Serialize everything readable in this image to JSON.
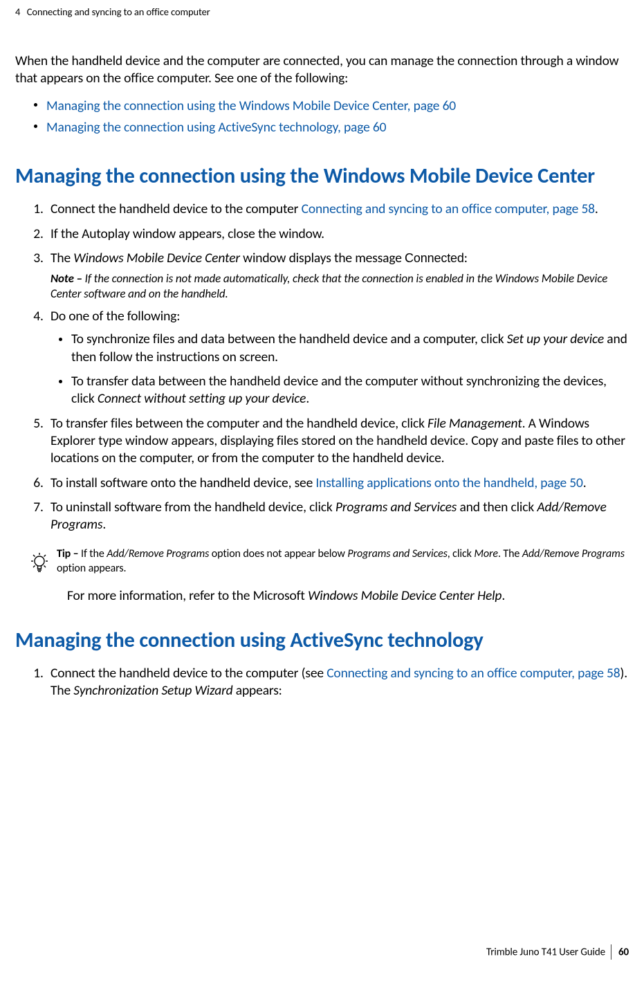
{
  "header": {
    "chapter_num": "4",
    "chapter_title": "Connecting and syncing to an office computer"
  },
  "intro": "When the handheld device and the computer are connected, you can manage the connection through a window that appears on the office computer. See one of the following:",
  "top_links": [
    "Managing the connection using the Windows Mobile Device Center, page 60",
    "Managing the connection using ActiveSync technology, page 60"
  ],
  "section1": {
    "heading": "Managing the connection using the Windows Mobile Device Center",
    "step1_a": "Connect the handheld device to the computer ",
    "step1_link": "Connecting and syncing to an office computer, page 58",
    "step1_b": ".",
    "step2": "If the Autoplay window appears, close the window.",
    "step3_a": "The ",
    "step3_i": "Windows Mobile Device Center",
    "step3_b": " window displays the message ",
    "step3_ui": "Connected",
    "step3_c": ":",
    "note_label": "Note  – ",
    "note_body": "If the connection is not made automatically, check that the connection is enabled in the Windows Mobile Device Center software and on the handheld.",
    "step4": "Do one of the following:",
    "step4_bullet1_a": "To synchronize files and data between the handheld device and a computer, click ",
    "step4_bullet1_i": "Set up your device",
    "step4_bullet1_b": " and then follow the instructions on screen.",
    "step4_bullet2_a": "To transfer data between the handheld device and the computer without synchronizing the devices, click ",
    "step4_bullet2_i": "Connect without setting up your device",
    "step4_bullet2_b": ".",
    "step5_a": "To transfer files between the computer and the handheld device, click ",
    "step5_i": "File Management",
    "step5_b": ". A Windows Explorer type window appears, displaying files stored on the handheld device. Copy and paste files to other locations on the computer, or from the computer to the handheld device.",
    "step6_a": "To install software onto the handheld device, see ",
    "step6_link": "Installing applications onto the handheld, page 50",
    "step6_b": ".",
    "step7_a": "To uninstall software from the handheld device, click ",
    "step7_i1": "Programs and Services",
    "step7_b": " and then click ",
    "step7_i2": "Add/Remove Programs",
    "step7_c": ".",
    "tip_label": "Tip  – ",
    "tip_a": "If the ",
    "tip_i1": "Add/Remove Programs",
    "tip_b": " option does not appear below ",
    "tip_i2": "Programs and Services",
    "tip_c": ", click ",
    "tip_i3": "More",
    "tip_d": ". The ",
    "tip_i4": "Add/Remove Programs",
    "tip_e": " option appears.",
    "more_info_a": "For more information, refer to the Microsoft ",
    "more_info_i": "Windows Mobile Device Center Help",
    "more_info_b": "."
  },
  "section2": {
    "heading": "Managing the connection using ActiveSync technology",
    "step1_a": "Connect the handheld device to the computer (see ",
    "step1_link": "Connecting and syncing to an office computer, page 58",
    "step1_b": "). The ",
    "step1_i": "Synchronization Setup Wizard",
    "step1_c": " appears:"
  },
  "footer": {
    "guide": "Trimble Juno T41 User Guide",
    "page": "60"
  }
}
